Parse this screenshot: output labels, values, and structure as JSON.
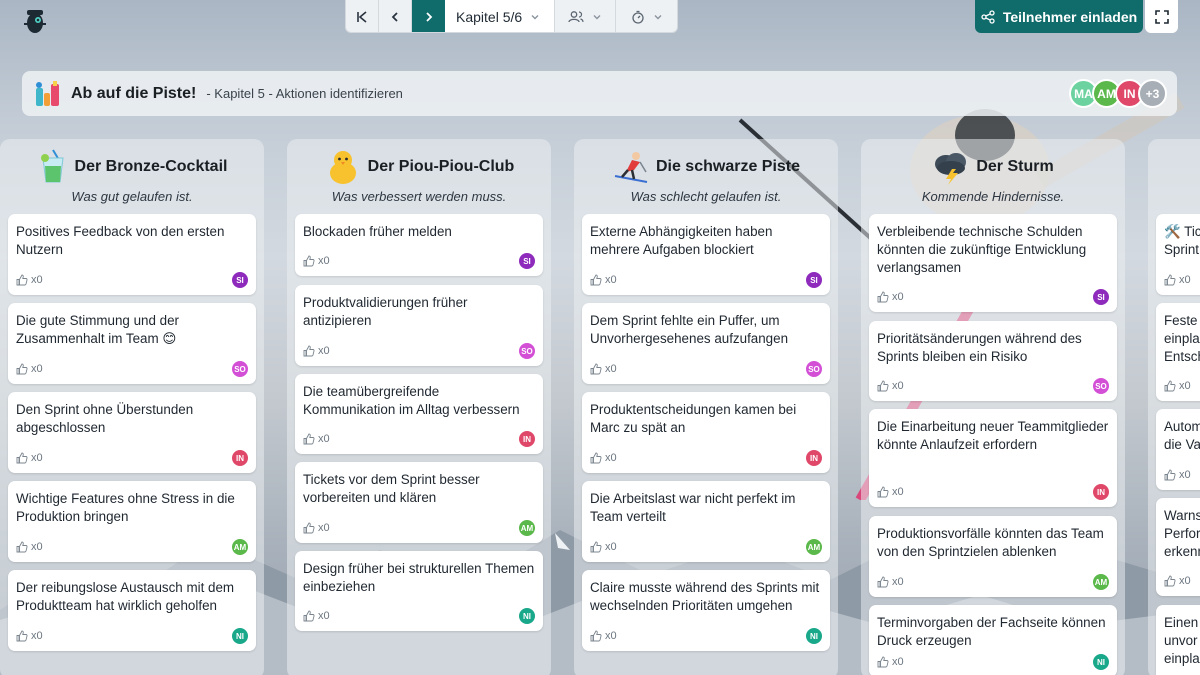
{
  "toolbar": {
    "chapter_label": "Kapitel 5/6",
    "invite_label": "Teilnehmer einladen"
  },
  "board": {
    "title": "Ab auf die Piste!",
    "subtitle": "- Kapitel 5 - Aktionen identifizieren",
    "participants": [
      {
        "initials": "MA",
        "color": "#6cd3a0"
      },
      {
        "initials": "AM",
        "color": "#5bb84a"
      },
      {
        "initials": "IN",
        "color": "#e0486a"
      }
    ],
    "more_participants": "+3"
  },
  "columns": [
    {
      "title": "Der Bronze-Cocktail",
      "subtitle": "Was gut gelaufen ist.",
      "icon": "cocktail-icon",
      "cards": [
        {
          "text": "Positives Feedback von den ersten Nutzern",
          "likes": "x0",
          "author": "SI",
          "color": "#8e2bbd"
        },
        {
          "text": "Die gute Stimmung und der Zusammenhalt im Team 😊",
          "likes": "x0",
          "author": "SO",
          "color": "#d24fd6"
        },
        {
          "text": "Den Sprint ohne Überstunden abgeschlossen",
          "likes": "x0",
          "author": "IN",
          "color": "#e0486a"
        },
        {
          "text": "Wichtige Features ohne Stress in die Produktion bringen",
          "likes": "x0",
          "author": "AM",
          "color": "#5bb84a"
        },
        {
          "text": "Der reibungslose Austausch mit dem Produktteam hat wirklich geholfen",
          "likes": "x0",
          "author": "NI",
          "color": "#1aa88a"
        }
      ]
    },
    {
      "title": "Der Piou-Piou-Club",
      "subtitle": "Was verbessert werden muss.",
      "icon": "chick-icon",
      "cards": [
        {
          "text": "Blockaden früher melden",
          "likes": "x0",
          "author": "SI",
          "color": "#8e2bbd"
        },
        {
          "text": "Produktvalidierungen früher antizipieren",
          "likes": "x0",
          "author": "SO",
          "color": "#d24fd6"
        },
        {
          "text": "Die teamübergreifende Kommunikation im Alltag verbessern",
          "likes": "x0",
          "author": "IN",
          "color": "#e0486a"
        },
        {
          "text": "Tickets vor dem Sprint besser vorbereiten und klären",
          "likes": "x0",
          "author": "AM",
          "color": "#5bb84a"
        },
        {
          "text": "Design früher bei strukturellen Themen einbeziehen",
          "likes": "x0",
          "author": "NI",
          "color": "#1aa88a"
        }
      ]
    },
    {
      "title": "Die schwarze Piste",
      "subtitle": "Was schlecht gelaufen ist.",
      "icon": "skier-icon",
      "cards": [
        {
          "text": "Externe Abhängigkeiten haben mehrere Aufgaben blockiert",
          "likes": "x0",
          "author": "SI",
          "color": "#8e2bbd"
        },
        {
          "text": "Dem Sprint fehlte ein Puffer, um Unvorhergesehenes aufzufangen",
          "likes": "x0",
          "author": "SO",
          "color": "#d24fd6"
        },
        {
          "text": "Produktentscheidungen kamen bei Marc zu spät an",
          "likes": "x0",
          "author": "IN",
          "color": "#e0486a"
        },
        {
          "text": "Die Arbeitslast war nicht perfekt im Team verteilt",
          "likes": "x0",
          "author": "AM",
          "color": "#5bb84a"
        },
        {
          "text": "Claire musste während des Sprints mit wechselnden Prioritäten umgehen",
          "likes": "x0",
          "author": "NI",
          "color": "#1aa88a"
        }
      ]
    },
    {
      "title": "Der Sturm",
      "subtitle": "Kommende Hindernisse.",
      "icon": "storm-cloud-icon",
      "cards": [
        {
          "text": "Verbleibende technische Schulden könnten die zukünftige Entwicklung verlangsamen",
          "likes": "x0",
          "author": "SI",
          "color": "#8e2bbd"
        },
        {
          "text": "Prioritätsänderungen während des Sprints bleiben ein Risiko",
          "likes": "x0",
          "author": "SO",
          "color": "#d24fd6"
        },
        {
          "text": "Die Einarbeitung neuer Teammitglieder könnte Anlaufzeit erfordern",
          "likes": "x0",
          "author": "IN",
          "color": "#e0486a"
        },
        {
          "text": "Produktionsvorfälle könnten das Team von den Sprintzielen ablenken",
          "likes": "x0",
          "author": "AM",
          "color": "#5bb84a"
        },
        {
          "text": "Terminvorgaben der Fachseite können Druck erzeugen",
          "likes": "x0",
          "author": "NI",
          "color": "#1aa88a"
        }
      ]
    },
    {
      "title": "",
      "subtitle": "",
      "icon": "",
      "cards": [
        {
          "text": "🛠️ Tic",
          "text2": "Sprint",
          "likes": "x0"
        },
        {
          "text": "Feste",
          "text2": "einpla",
          "text3": "Entsch",
          "likes": "x0"
        },
        {
          "text": "Autom",
          "text2": "die Va",
          "likes": "x0"
        },
        {
          "text": "Warns",
          "text2": "Perfor",
          "text3": "erkenn",
          "likes": "x0"
        },
        {
          "text": "Einen",
          "text2": "unvor",
          "text3": "einpla",
          "likes": "x0"
        }
      ]
    }
  ]
}
